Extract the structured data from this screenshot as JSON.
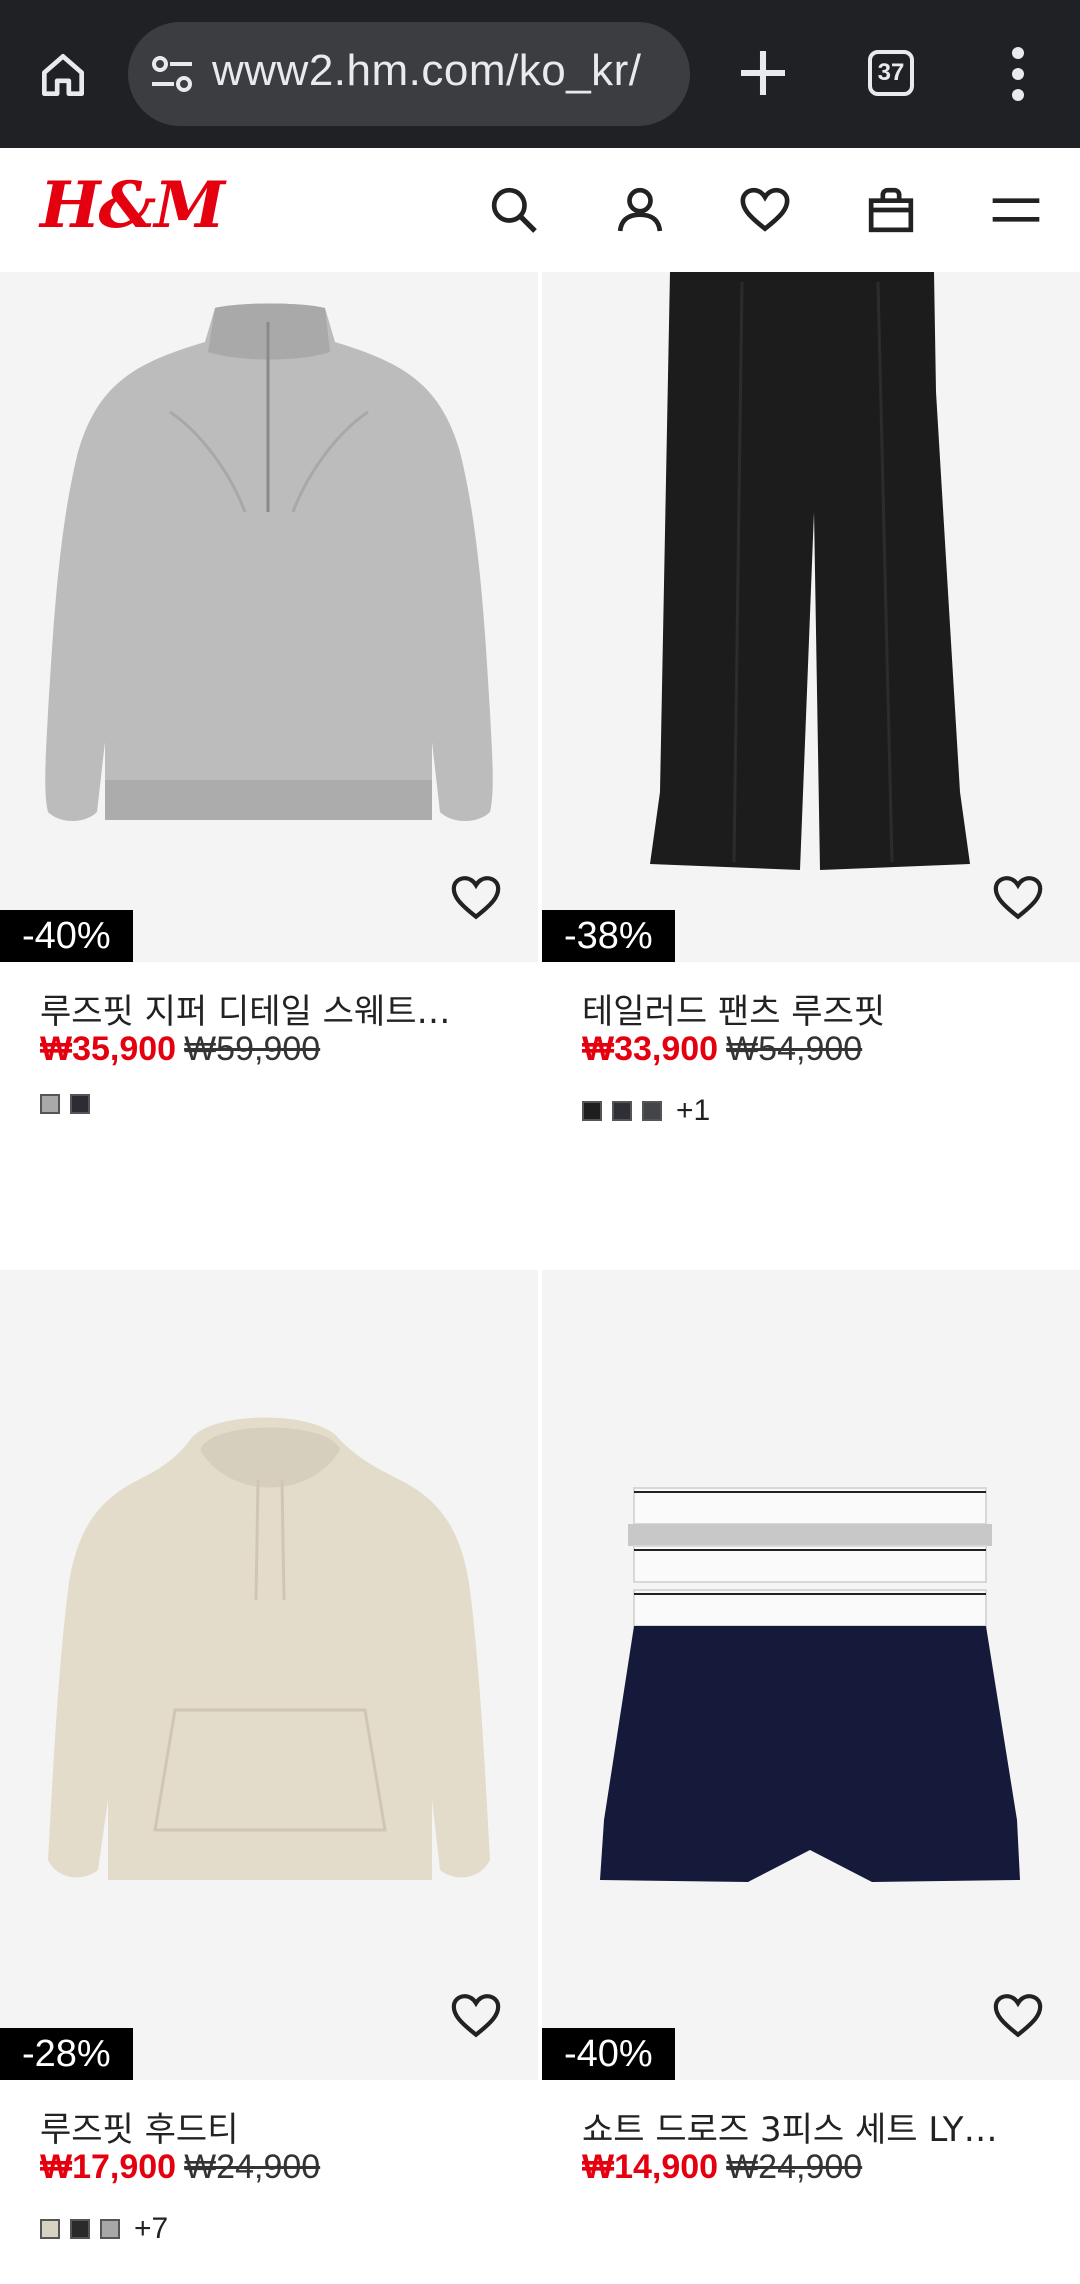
{
  "browser": {
    "url": "www2.hm.com/ko_kr/",
    "tab_count": "37"
  },
  "header": {
    "logo": "H&M"
  },
  "products": [
    {
      "discount": "-40%",
      "title": "루즈핏 지퍼 디테일 스웨트…",
      "sale_price": "₩35,900",
      "original_price": "₩59,900",
      "swatches": [
        "#a9a9a9",
        "#2b2d33"
      ],
      "more_colors": ""
    },
    {
      "discount": "-38%",
      "title": "테일러드 팬츠 루즈핏",
      "sale_price": "₩33,900",
      "original_price": "₩54,900",
      "swatches": [
        "#1e1e1e",
        "#2f3035",
        "#444548"
      ],
      "more_colors": "+1"
    },
    {
      "discount": "-28%",
      "title": "루즈핏 후드티",
      "sale_price": "₩17,900",
      "original_price": "₩24,900",
      "swatches": [
        "#d8d2c2",
        "#2a2a2a",
        "#a8a8a8"
      ],
      "more_colors": "+7"
    },
    {
      "discount": "-40%",
      "title": "쇼트 드로즈 3피스 세트 LY…",
      "sale_price": "₩14,900",
      "original_price": "₩24,900",
      "swatches": [],
      "more_colors": ""
    }
  ],
  "colors": {
    "brand_red": "#e50010",
    "browser_bg": "#202124",
    "image_bg": "#f4f4f4"
  }
}
